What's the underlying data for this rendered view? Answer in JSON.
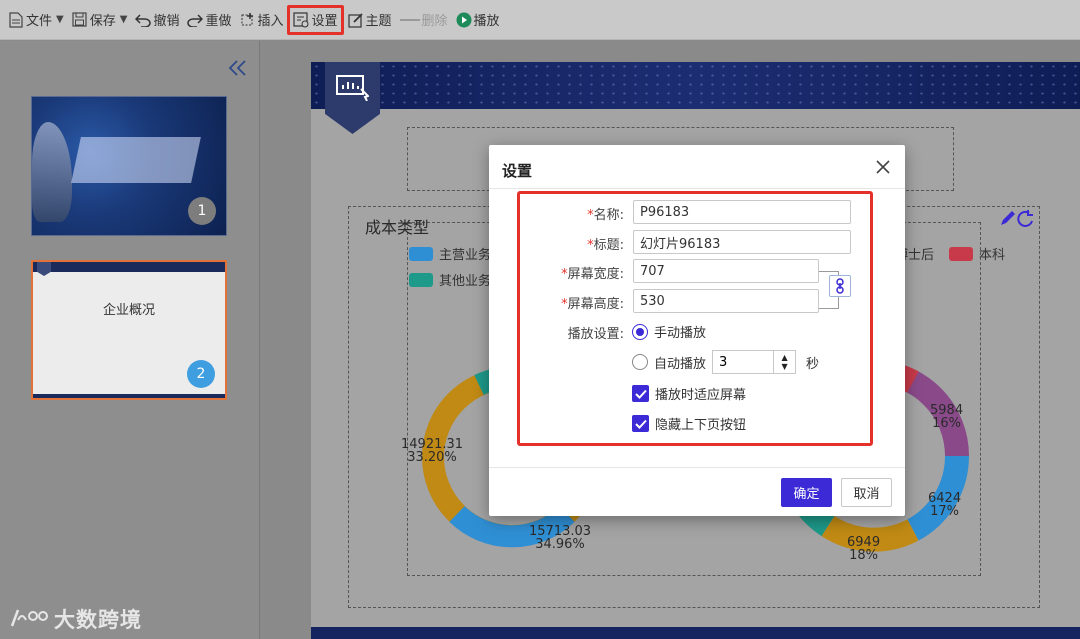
{
  "toolbar": {
    "file": "文件",
    "save": "保存",
    "undo": "撤销",
    "redo": "重做",
    "insert": "插入",
    "settings": "设置",
    "theme": "主题",
    "delete": "删除",
    "play": "播放"
  },
  "slides": [
    {
      "number": "1"
    },
    {
      "number": "2",
      "title": "企业概况"
    }
  ],
  "chart_data": [
    {
      "type": "pie",
      "title": "成本类型",
      "legend": [
        "主营业务",
        "其他业务"
      ],
      "labels": [
        {
          "value": "14921.31",
          "percent": "33.20%"
        },
        {
          "value": "15713.03",
          "percent": "34.96%"
        }
      ],
      "colors": {
        "gold": "#c08a14",
        "blue": "#2f8fd4",
        "teal": "#1e9a8a"
      }
    },
    {
      "type": "pie",
      "legend": [
        "博士后",
        "本科"
      ],
      "labels": [
        {
          "value": "5984",
          "percent": "16%"
        },
        {
          "value": "6424",
          "percent": "17%"
        },
        {
          "value": "6949",
          "percent": "18%"
        }
      ],
      "colors": {
        "purple": "#8a4a8a",
        "blue": "#2f8fd4",
        "gold": "#c08a14",
        "red": "#c83a4a"
      }
    }
  ],
  "dialog": {
    "title": "设置",
    "name_label": "名称:",
    "name_value": "P96183",
    "caption_label": "标题:",
    "caption_value": "幻灯片96183",
    "width_label": "屏幕宽度:",
    "width_value": "707",
    "height_label": "屏幕高度:",
    "height_value": "530",
    "play_label": "播放设置:",
    "manual_play": "手动播放",
    "auto_play": "自动播放",
    "auto_seconds": "3",
    "seconds_unit": "秒",
    "fit_screen": "播放时适应屏幕",
    "hide_nav": "隐藏上下页按钮",
    "ok": "确定",
    "cancel": "取消",
    "required_mark": "*"
  },
  "watermark": {
    "text": "大数跨境"
  },
  "colors": {
    "accent": "#3b2ad6",
    "highlight_red": "#e4322b"
  }
}
